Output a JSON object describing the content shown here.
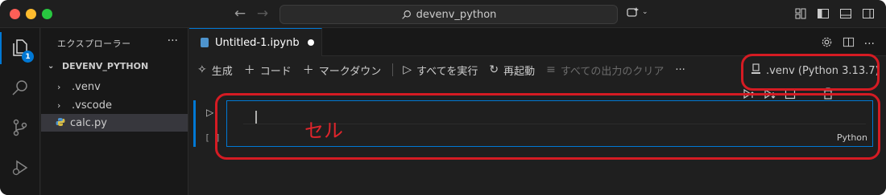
{
  "titlebar": {
    "search_text": "devenv_python"
  },
  "activity_bar": {
    "explorer_badge": "1"
  },
  "sidebar": {
    "title": "エクスプローラー",
    "more_label": "···",
    "folder_name": "DEVENV_PYTHON",
    "items": [
      {
        "label": ".venv"
      },
      {
        "label": ".vscode"
      },
      {
        "label": "calc.py"
      }
    ]
  },
  "editor": {
    "tab_label": "Untitled-1.ipynb",
    "toolbar": {
      "generate": "生成",
      "code": "コード",
      "markdown": "マークダウン",
      "run_all": "すべてを実行",
      "restart": "再起動",
      "clear_outputs": "すべての出力のクリア",
      "more": "···"
    },
    "kernel": ".venv (Python 3.13.7)",
    "cell": {
      "exec_count": "[ ]",
      "language": "Python"
    }
  },
  "annotation": {
    "cell_label": "セル",
    "color": "#d51b23"
  }
}
